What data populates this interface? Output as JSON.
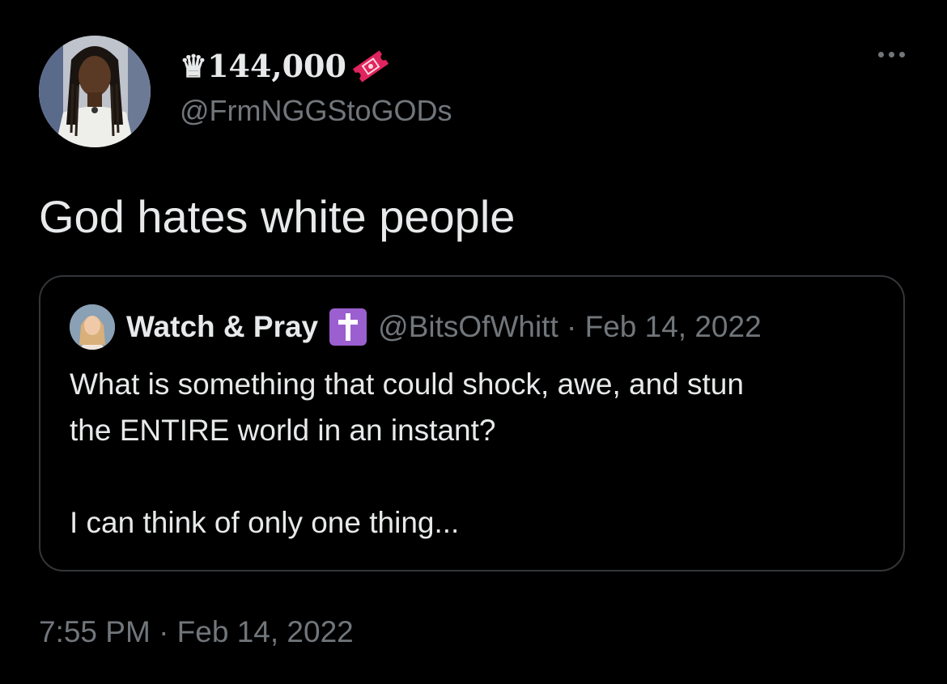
{
  "tweet": {
    "author": {
      "display_name": "♛144,000",
      "handle": "@FrmNGGStoGODs",
      "avatar_icon": "avatar-illustrated-man",
      "ticket_icon": "ticket-emoji",
      "ticket_color": "#e0245e"
    },
    "text": "God hates white people",
    "timestamp": "7:55 PM · Feb 14, 2022"
  },
  "quoted_tweet": {
    "author_name": "Watch & Pray",
    "badge_icon": "latin-cross-emoji",
    "badge_color": "#9b5fd0",
    "handle_date": "@BitsOfWhitt · Feb 14, 2022",
    "lines": [
      "What is something that could shock, awe, and stun",
      "the ENTIRE world in an instant?",
      "I can think of only one thing..."
    ]
  },
  "colors": {
    "background": "#000000",
    "text_primary": "#e7e9ea",
    "text_secondary": "#71767b",
    "border": "#333639"
  }
}
